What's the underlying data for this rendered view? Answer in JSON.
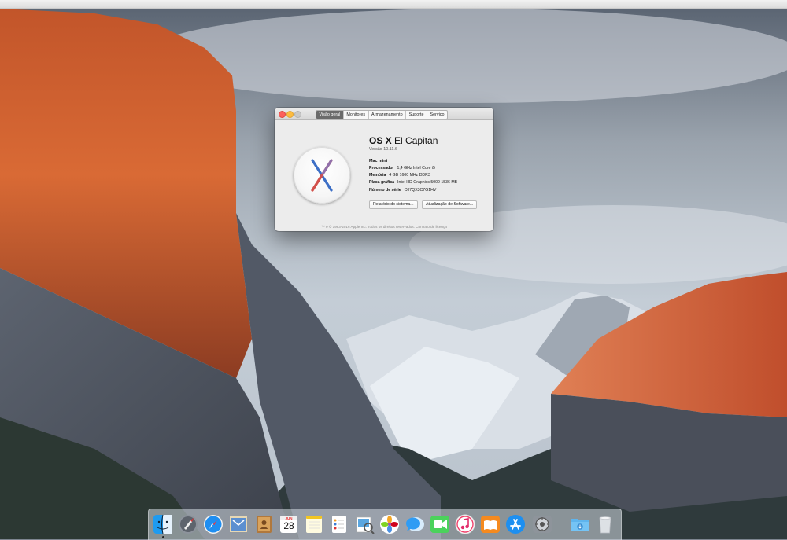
{
  "window": {
    "tabs": [
      "Visão geral",
      "Monitores",
      "Armazenamento",
      "Suporte",
      "Serviço"
    ],
    "os_name_bold": "OS X",
    "os_name_rest": "El Capitan",
    "version": "Versão 10.11.6",
    "model": "Mac mini",
    "specs": [
      {
        "label": "Processador",
        "value": "1,4 GHz Intel Core i5"
      },
      {
        "label": "Memória",
        "value": "4 GB 1600 MHz DDR3"
      },
      {
        "label": "Placa gráfica",
        "value": "Intel HD Graphics 5000 1536 MB"
      },
      {
        "label": "Número de série",
        "value": "C07QX3C7G1HV"
      }
    ],
    "buttons": {
      "report": "Relatório do sistema...",
      "update": "Atualização de Software..."
    },
    "footer": "™ e © 1983-2016 Apple Inc. Todos os direitos reservados.  Contrato de licença"
  },
  "dock": {
    "calendar_month": "JUN",
    "calendar_day": "28",
    "icons": [
      "finder-icon",
      "launchpad-icon",
      "safari-icon",
      "mail-icon",
      "contacts-icon",
      "calendar-icon",
      "notes-icon",
      "reminders-icon",
      "preview-icon",
      "photos-icon",
      "messages-icon",
      "facetime-icon",
      "itunes-icon",
      "ibooks-icon",
      "app-store-icon",
      "system-preferences-icon",
      "downloads-folder-icon",
      "trash-icon"
    ]
  },
  "colors": {
    "close": "#fc605c",
    "minimize": "#fdbc40",
    "zoom": "#c8c8c8",
    "tab_active": "#6b6b6b"
  }
}
